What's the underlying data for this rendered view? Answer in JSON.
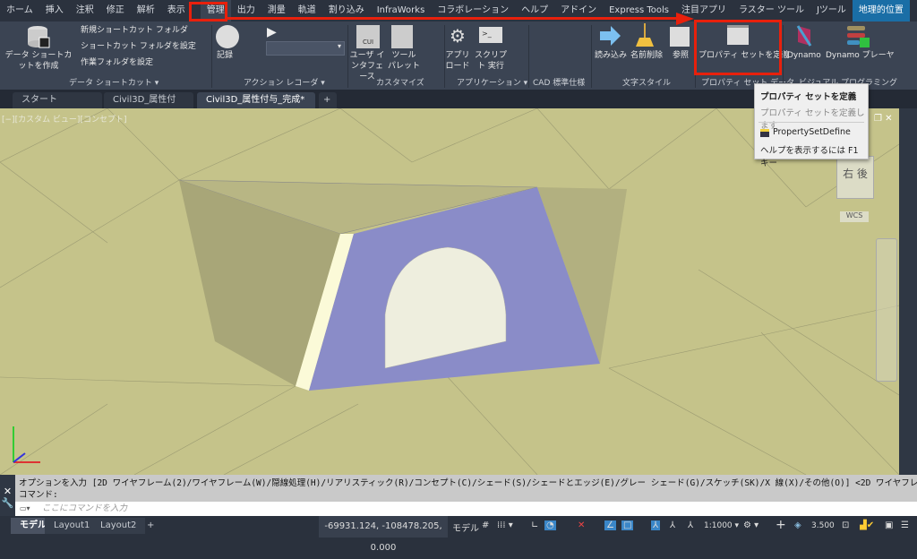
{
  "menu_tabs": [
    "ホーム",
    "挿入",
    "注釈",
    "修正",
    "解析",
    "表示",
    "管理",
    "出力",
    "測量",
    "軌道",
    "割り込み",
    "InfraWorks",
    "コラボレーション",
    "ヘルプ",
    "アドイン",
    "Express Tools",
    "注目アプリ",
    "ラスター ツール",
    "Jツール",
    "地理的位置"
  ],
  "active_tab": "管理",
  "ribbon": {
    "data_shortcut": {
      "create": "データ ショートカットを作成",
      "new_folder": "新規ショートカット フォルダ",
      "set_folder": "ショートカット フォルダを設定",
      "work_folder": "作業フォルダを設定",
      "panel": "データ ショートカット ▾"
    },
    "action_recorder": {
      "record": "記録",
      "panel": "アクション レコーダ ▾"
    },
    "customize": {
      "cui_text": "CUI",
      "user_interface": "ユーザ インタフェース",
      "tool_palette": "ツール パレット",
      "panel": "カスタマイズ"
    },
    "applications": {
      "app_load": "アプリ ロード",
      "script": "スクリプト 実行",
      "panel": "アプリケーション ▾"
    },
    "cad_standards": {
      "panel": "CAD 標準仕様"
    },
    "text_style": {
      "import": "読み込み",
      "purge": "名前削除",
      "reference": "参照",
      "panel": "文字スタイル"
    },
    "property_set": {
      "define": "プロパティ セットを定義",
      "panel": "プロパティ セット データ"
    },
    "visual_programming": {
      "dynamo": "Dynamo",
      "dynamo_player": "Dynamo プレーヤ",
      "panel": "ビジュアル プログラミング"
    }
  },
  "file_tabs": [
    {
      "label": "スタート"
    },
    {
      "label": "Civil3D_属性付与"
    },
    {
      "label": "Civil3D_属性付与_完成*"
    }
  ],
  "viewport": {
    "view_label": "[−][カスタム ビュー][コンセプト]",
    "viewcube_right": "右",
    "viewcube_back": "後",
    "wcs": "WCS"
  },
  "tooltip": {
    "title": "プロパティ セットを定義",
    "description": "プロパティ セットを定義します",
    "command": "PropertySetDefine",
    "help": "ヘルプを表示するには F1 キー"
  },
  "command_line": {
    "history1": "オプションを入力 [2D ワイヤフレーム(2)/ワイヤフレーム(W)/隠線処理(H)/リアリスティック(R)/コンセプト(C)/シェード(S)/シェードとエッジ(E)/グレー シェード(G)/スケッチ(SK)/X 線(X)/その他(O)] <2D ワイヤフレーム>: _c",
    "history2": "コマンド:",
    "placeholder": "ここにコマンドを入力"
  },
  "layout_tabs": [
    "モデル",
    "Layout1",
    "Layout2"
  ],
  "status": {
    "coords": "-69931.124, -108478.205, 0.000",
    "space": "モデル",
    "scale": "1:1000",
    "lineweight": "3.500"
  },
  "colors": {
    "highlight": "#e8200c",
    "culvert_face": "#8a8cc8",
    "terrain": "#c5c38a",
    "geo_tab": "#1a6ea6"
  }
}
